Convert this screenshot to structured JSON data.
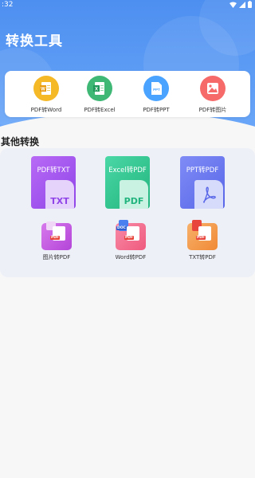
{
  "status": {
    "time": ":32"
  },
  "header": {
    "title": "转换工具"
  },
  "tools": [
    {
      "label": "PDF转Word",
      "icon": "word-doc-icon",
      "color": "#f5b826"
    },
    {
      "label": "PDF转Excel",
      "icon": "excel-doc-icon",
      "color": "#3fb876"
    },
    {
      "label": "PDF转PPT",
      "icon": "ppt-doc-icon",
      "color": "#4aa3ff"
    },
    {
      "label": "PDF转图片",
      "icon": "image-doc-icon",
      "color": "#f66a6a"
    }
  ],
  "other": {
    "title": "其他转换",
    "cards": [
      {
        "label": "PDF转TXT",
        "ext": "TXT",
        "color": "#a259f0"
      },
      {
        "label": "Excel转PDF",
        "ext": "PDF",
        "color": "#35c996"
      },
      {
        "label": "PPT转PDF",
        "ext": "PDF",
        "color": "#6f7df2"
      }
    ],
    "items": [
      {
        "label": "图片转PDF",
        "tag": "PDF",
        "color": "#c456e0"
      },
      {
        "label": "Word转PDF",
        "tag": "PDF",
        "color": "#f36a8c",
        "tag2": "DOC"
      },
      {
        "label": "TXT转PDF",
        "tag": "PDF",
        "color": "#f39a4a"
      }
    ]
  }
}
